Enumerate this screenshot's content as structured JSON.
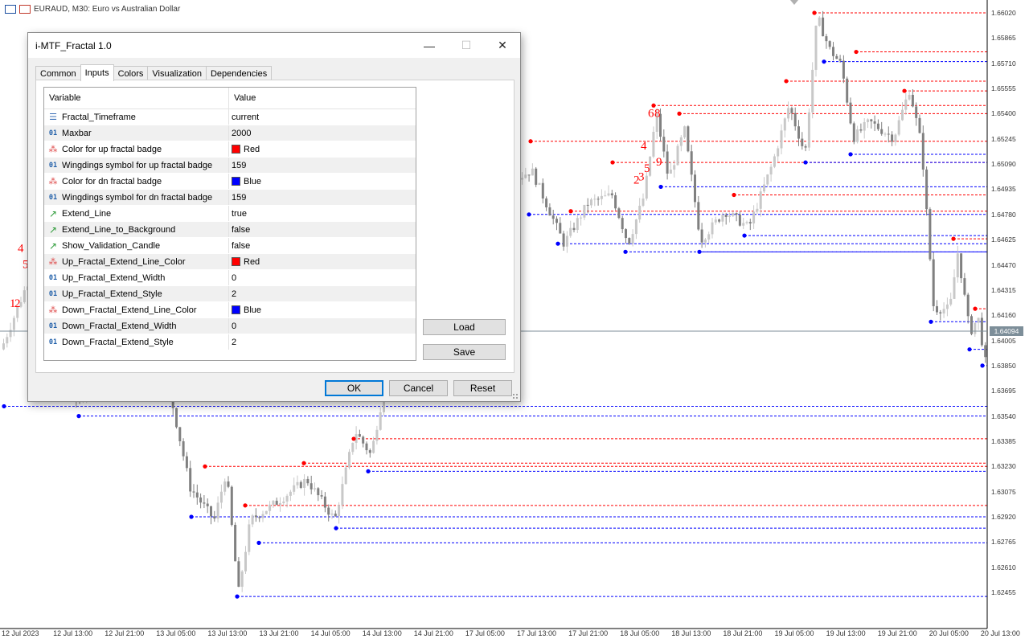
{
  "chart": {
    "symbol_title": "EURAUD, M30:  Euro vs Australian Dollar",
    "current_price": "1.64094",
    "price_labels": [
      "1.66020",
      "1.65865",
      "1.65710",
      "1.65555",
      "1.65400",
      "1.65245",
      "1.65090",
      "1.64935",
      "1.64780",
      "1.64625",
      "1.64470",
      "1.64315",
      "1.64160",
      "1.64005",
      "1.63850",
      "1.63695",
      "1.63540",
      "1.63385",
      "1.63230",
      "1.63075",
      "1.62920",
      "1.62765",
      "1.62610",
      "1.62455"
    ],
    "time_labels": [
      "12 Jul 2023",
      "12 Jul 13:00",
      "12 Jul 21:00",
      "13 Jul 05:00",
      "13 Jul 13:00",
      "13 Jul 21:00",
      "14 Jul 05:00",
      "14 Jul 13:00",
      "14 Jul 21:00",
      "17 Jul 05:00",
      "17 Jul 13:00",
      "17 Jul 21:00",
      "18 Jul 05:00",
      "18 Jul 13:00",
      "18 Jul 21:00",
      "19 Jul 05:00",
      "19 Jul 13:00",
      "19 Jul 21:00",
      "20 Jul 05:00",
      "20 Jul 13:00"
    ],
    "wave_labels": [
      {
        "text": "4",
        "price": 1.6455
      },
      {
        "text": "5",
        "price": 1.6445
      },
      {
        "text": "1",
        "price": 1.6421
      },
      {
        "text": "2",
        "price": 1.6421
      },
      {
        "text": "6",
        "price": 1.6538
      },
      {
        "text": "8",
        "price": 1.6538
      },
      {
        "text": "4",
        "price": 1.6518
      },
      {
        "text": "5",
        "price": 1.6504
      },
      {
        "text": "9",
        "price": 1.6508
      },
      {
        "text": "3",
        "price": 1.6499
      },
      {
        "text": "2",
        "price": 1.6497
      }
    ],
    "colors": {
      "up": "#ff0000",
      "down": "#0000ff",
      "bull": "#c8c8c8",
      "bear": "#808080",
      "background": "#ffffff",
      "axis_badge": "#7d8e99"
    }
  },
  "dialog": {
    "title": "i-MTF_Fractal 1.0",
    "window_controls": {
      "minimize": "—",
      "maximize": "☐",
      "close": "✕"
    },
    "tabs": [
      "Common",
      "Inputs",
      "Colors",
      "Visualization",
      "Dependencies"
    ],
    "active_tab": "Inputs",
    "grid_headers": {
      "variable": "Variable",
      "value": "Value"
    },
    "params": [
      {
        "icon": "enum",
        "name": "Fractal_Timeframe",
        "value": "current"
      },
      {
        "icon": "int",
        "name": "Maxbar",
        "value": "2000"
      },
      {
        "icon": "color",
        "name": "Color for up fractal badge",
        "value": "Red",
        "swatch": "#ff0000"
      },
      {
        "icon": "int",
        "name": "Wingdings symbol for up fractal badge",
        "value": "159"
      },
      {
        "icon": "color",
        "name": "Color for dn fractal badge",
        "value": "Blue",
        "swatch": "#0000ff"
      },
      {
        "icon": "int",
        "name": "Wingdings symbol for dn fractal badge",
        "value": "159"
      },
      {
        "icon": "bool",
        "name": "Extend_Line",
        "value": "true"
      },
      {
        "icon": "bool",
        "name": "Extend_Line_to_Background",
        "value": "false"
      },
      {
        "icon": "bool",
        "name": "Show_Validation_Candle",
        "value": "false"
      },
      {
        "icon": "color",
        "name": "Up_Fractal_Extend_Line_Color",
        "value": "Red",
        "swatch": "#ff0000"
      },
      {
        "icon": "int",
        "name": "Up_Fractal_Extend_Width",
        "value": "0"
      },
      {
        "icon": "int",
        "name": "Up_Fractal_Extend_Style",
        "value": "2"
      },
      {
        "icon": "color",
        "name": "Down_Fractal_Extend_Line_Color",
        "value": "Blue",
        "swatch": "#0000ff"
      },
      {
        "icon": "int",
        "name": "Down_Fractal_Extend_Width",
        "value": "0"
      },
      {
        "icon": "int",
        "name": "Down_Fractal_Extend_Style",
        "value": "2"
      }
    ],
    "side_buttons": {
      "load": "Load",
      "save": "Save"
    },
    "footer_buttons": {
      "ok": "OK",
      "cancel": "Cancel",
      "reset": "Reset"
    },
    "icon_glyphs": {
      "enum": "☰",
      "int": "01",
      "color": "⁂",
      "bool": "↗"
    }
  }
}
